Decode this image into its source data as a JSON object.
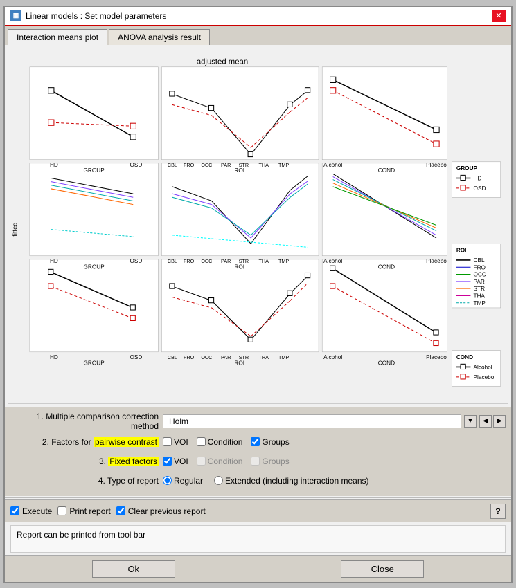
{
  "window": {
    "title": "Linear models : Set model parameters",
    "close_label": "✕"
  },
  "tabs": [
    {
      "label": "Interaction means plot",
      "active": true
    },
    {
      "label": "ANOVA analysis result",
      "active": false
    }
  ],
  "plot": {
    "title": "adjusted mean",
    "x_labels": [
      "HD",
      "OSD",
      "CBL",
      "FRO",
      "OCC",
      "PAR",
      "STR",
      "THA",
      "TMP",
      "Alcohol",
      "Placebo"
    ],
    "row_labels": [
      "GROUP",
      "ROI",
      "COND"
    ],
    "y_label": "fitted",
    "legend1_title": "GROUP",
    "legend1_items": [
      "HD",
      "OSD"
    ],
    "legend2_title": "ROI",
    "legend2_items": [
      "CBL",
      "FRO",
      "OCC",
      "PAR",
      "STR",
      "THA",
      "TMP"
    ],
    "legend3_title": "COND",
    "legend3_items": [
      "Alcohol",
      "Placebo"
    ]
  },
  "controls": {
    "row1_label": "1. Multiple comparison correction method",
    "row1_value": "Holm",
    "row2_label": "2. Factors for",
    "row2_highlight": "pairwise contrast",
    "row2_checkboxes": [
      {
        "label": "VOI",
        "checked": false
      },
      {
        "label": "Condition",
        "checked": false
      },
      {
        "label": "Groups",
        "checked": true
      }
    ],
    "row3_label": "3.",
    "row3_highlight": "Fixed factors",
    "row3_checkboxes": [
      {
        "label": "VOI",
        "checked": true
      },
      {
        "label": "Condition",
        "checked": false,
        "grayed": true
      },
      {
        "label": "Groups",
        "checked": false,
        "grayed": true
      }
    ],
    "row4_label": "4. Type of report",
    "row4_options": [
      {
        "label": "Regular",
        "selected": true
      },
      {
        "label": "Extended (including interaction means)",
        "selected": false
      }
    ]
  },
  "execute_bar": {
    "execute_checkbox": true,
    "execute_label": "Execute",
    "print_checkbox": false,
    "print_label": "Print report",
    "clear_checkbox": true,
    "clear_label": "Clear previous report",
    "help_label": "?"
  },
  "report_note": "Report can be printed from tool bar",
  "footer": {
    "ok_label": "Ok",
    "close_label": "Close"
  }
}
